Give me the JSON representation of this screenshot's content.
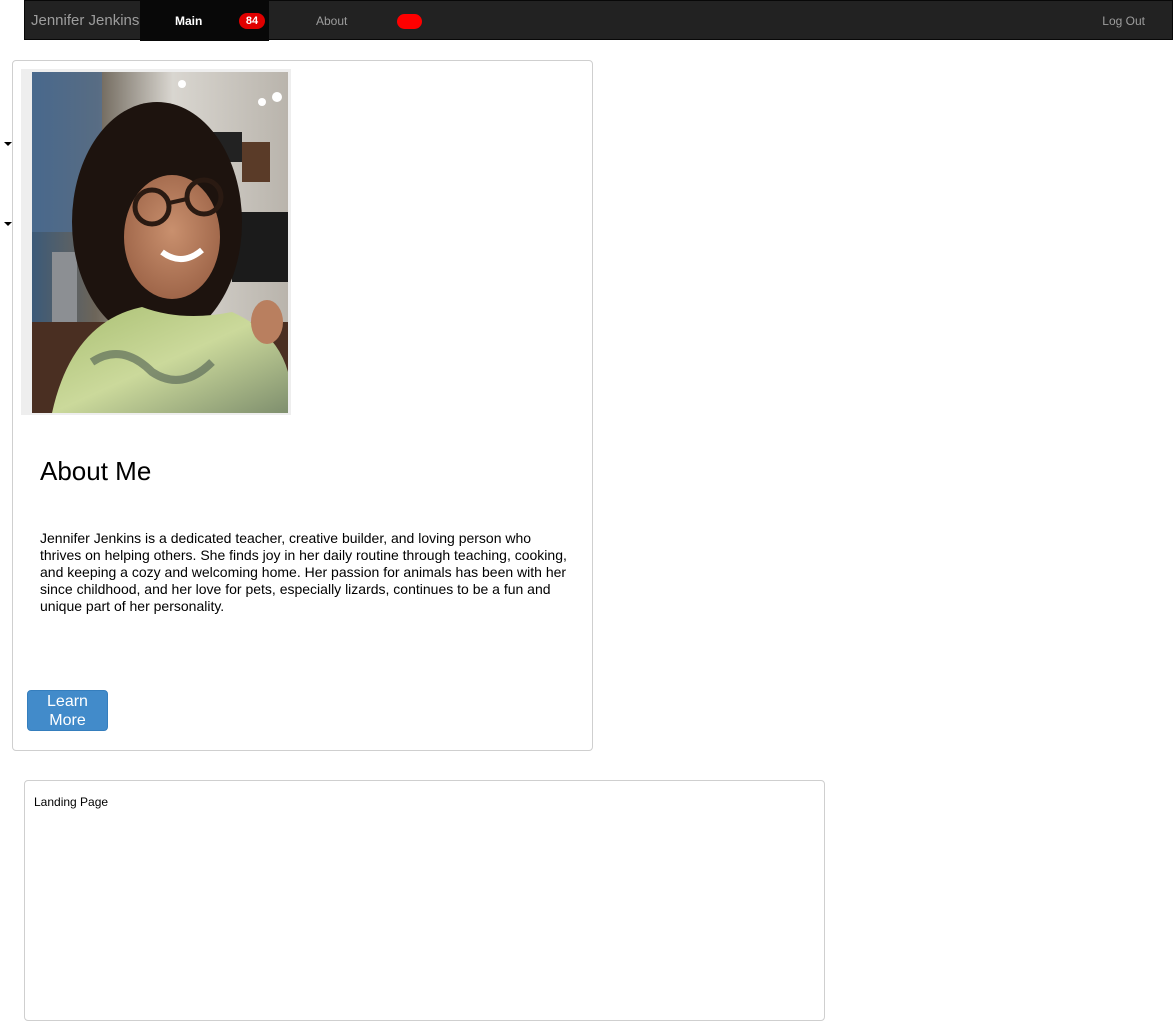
{
  "navbar": {
    "brand": "Jennifer Jenkins",
    "main_label": "Main",
    "main_badge": "84",
    "about_label": "About",
    "logout_label": "Log Out",
    "colors": {
      "bar": "#222222",
      "active": "#080808",
      "badge": "#e00000",
      "pill": "#ff0000"
    }
  },
  "profile": {
    "photo_alt": "photo of Jennifer Jenkins",
    "title": "About Me",
    "description": "Jennifer Jenkins is a dedicated teacher, creative builder, and loving person who thrives on helping others. She finds joy in her daily routine through teaching, cooking, and keeping a cozy and welcoming home. Her passion for animals has been with her since childhood, and her love for pets, especially lizards, continues to be a fun and unique part of her personality.",
    "button_label": "Learn More",
    "button_color": "#428bca"
  },
  "landing": {
    "label": "Landing Page"
  }
}
